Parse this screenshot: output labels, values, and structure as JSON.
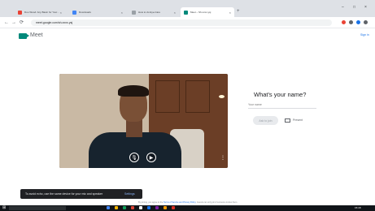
{
  "browser": {
    "tabs": [
      {
        "label": "Duo Wood: Any Basin for Your...",
        "favicon_color": "#e94235"
      },
      {
        "label": "Downloads",
        "favicon_color": "#4285f4"
      },
      {
        "label": "How to do Eye-Care",
        "favicon_color": "#9aa0a6"
      },
      {
        "label": "Meet – Sh-xxxx-ysj",
        "favicon_color": "#00897b"
      }
    ],
    "tab_close": "×",
    "new_tab": "+",
    "window_controls": {
      "minimize": "–",
      "maximize": "□",
      "close": "×"
    },
    "nav": {
      "back": "←",
      "forward": "→",
      "reload": "⟳"
    },
    "url": "meet.google.com/sh-xxxx-ysj",
    "extension_colors": [
      "#ea4335",
      "#5f6368",
      "#1a73e8",
      "#5f6368"
    ]
  },
  "meet": {
    "app_name": "Meet",
    "sign_in": "Sign in",
    "video_controls": {
      "mic_icon": "mic-icon",
      "camera_icon": "camera-icon",
      "more": "⋮"
    },
    "prompt": "What's your name?",
    "name_placeholder": "Your name",
    "join_label": "Ask to join",
    "present_label": "Present",
    "toast": {
      "message": "To avoid echo, use the same device for your mic and speaker",
      "action": "Settings"
    },
    "footer": {
      "prefix": "By joining, you agree to the ",
      "link": "Terms of Service and Privacy Policy",
      "suffix": ". Guests can only join if someone invites them."
    }
  },
  "taskbar": {
    "start_icon": "⊞",
    "time": "15:18",
    "icon_colors": [
      "#4285f4",
      "#f4b400",
      "#0f9d58",
      "#db4437",
      "#ffffff",
      "#1a73e8",
      "#7b1fa2",
      "#f29900",
      "#d93025"
    ]
  }
}
